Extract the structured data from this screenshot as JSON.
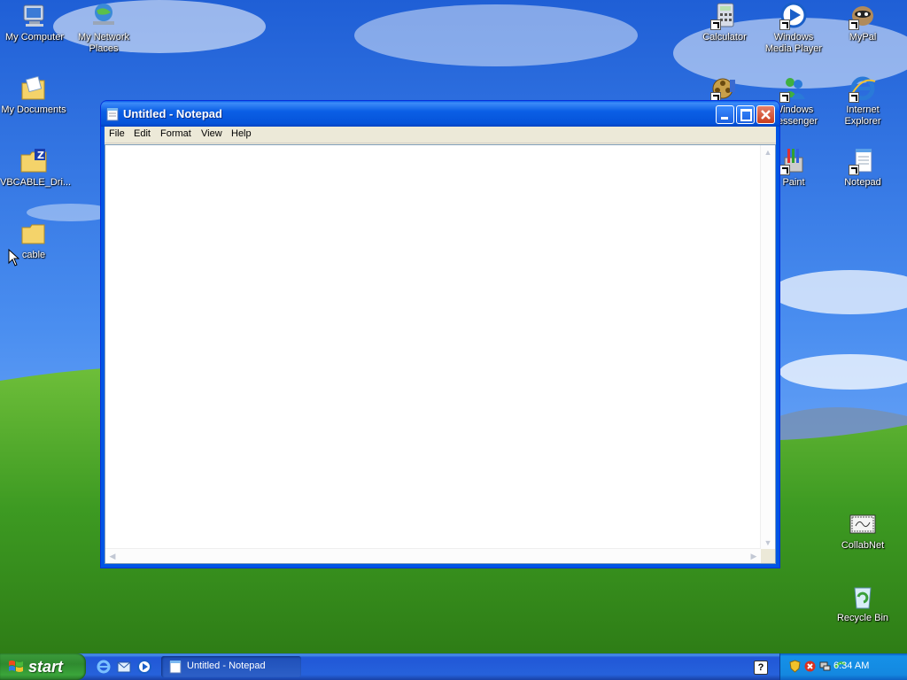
{
  "desktop": {
    "left_icons": [
      {
        "label": "My Computer",
        "icon": "my-computer-icon"
      },
      {
        "label": "My Network Places",
        "icon": "network-places-icon"
      },
      {
        "label": "My Documents",
        "icon": "my-documents-icon"
      },
      {
        "label": "VBCABLE_Dri...",
        "icon": "zip-folder-icon"
      },
      {
        "label": "cable",
        "icon": "folder-icon"
      }
    ],
    "right_icons": [
      {
        "label": "Calculator",
        "icon": "calculator-icon"
      },
      {
        "label": "Windows Media Player",
        "icon": "media-player-icon"
      },
      {
        "label": "MyPal",
        "icon": "mypal-icon"
      },
      {
        "label": "",
        "icon": "movie-maker-icon"
      },
      {
        "label": "Windows Messenger",
        "icon": "messenger-icon"
      },
      {
        "label": "Internet Explorer",
        "icon": "internet-explorer-icon"
      },
      {
        "label": "Paint",
        "icon": "paint-icon"
      },
      {
        "label": "Notepad",
        "icon": "notepad-icon"
      },
      {
        "label": "CollabNet",
        "icon": "collabnet-icon"
      },
      {
        "label": "Recycle Bin",
        "icon": "recycle-bin-icon"
      }
    ]
  },
  "window": {
    "title": "Untitled - Notepad",
    "menu": [
      "File",
      "Edit",
      "Format",
      "View",
      "Help"
    ],
    "content": ""
  },
  "taskbar": {
    "start_label": "start",
    "task_label": "Untitled - Notepad",
    "help_glyph": "?",
    "clock": "6:34 AM"
  },
  "colors": {
    "titlebar": "#0b5fe6",
    "taskbar": "#2662db",
    "start": "#3aa53a",
    "tray": "#1488e0"
  }
}
